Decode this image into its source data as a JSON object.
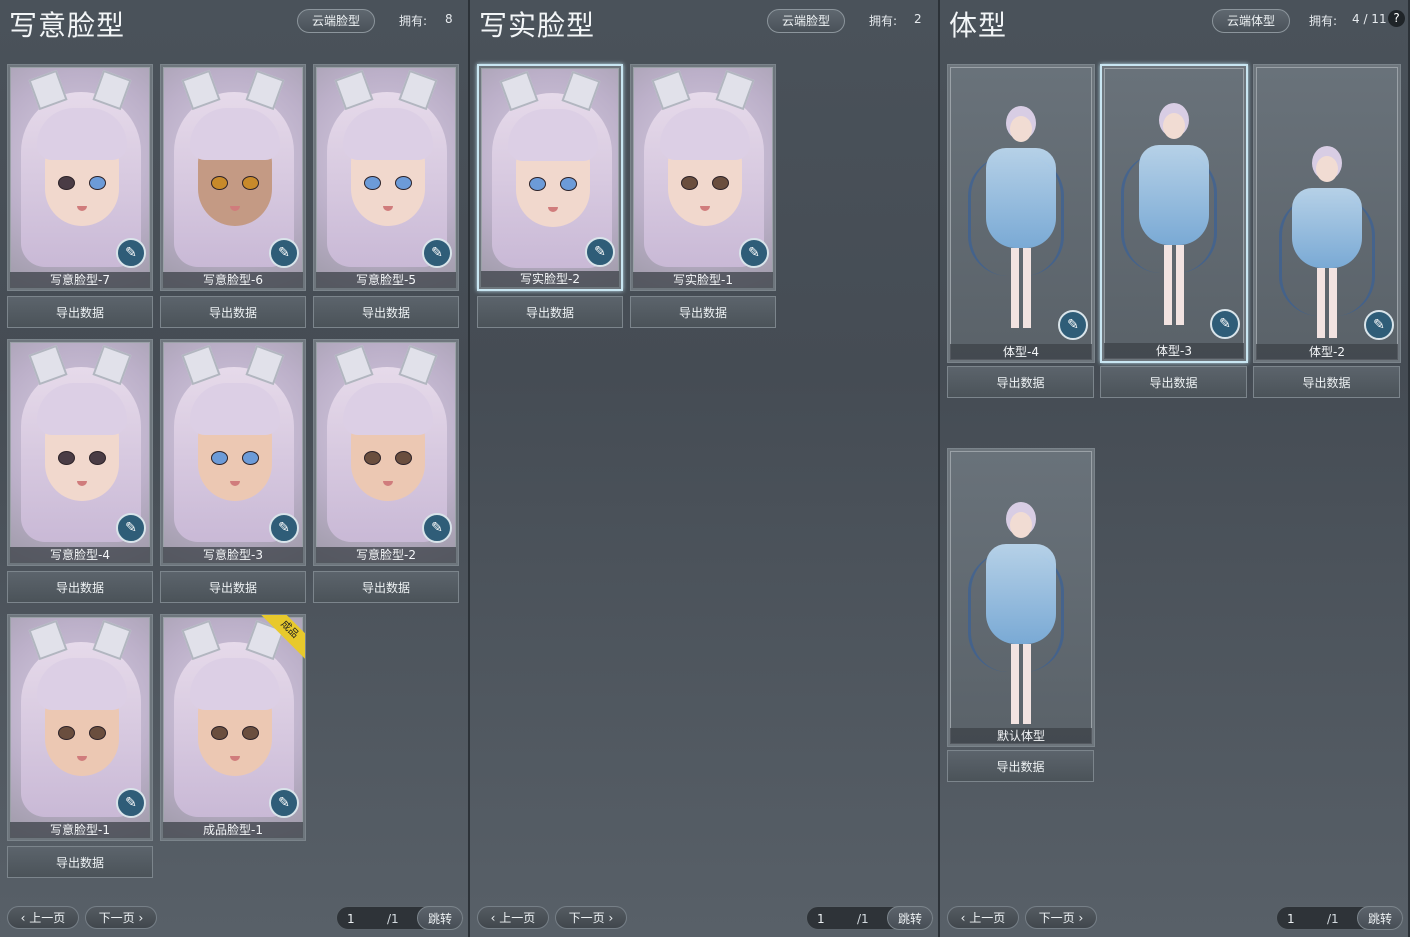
{
  "panels": [
    {
      "title": "写意脸型",
      "cloud_label": "云端脸型",
      "own_label": "拥有:",
      "own_value": "8",
      "cards": [
        {
          "name": "写意脸型-7",
          "export": "导出数据"
        },
        {
          "name": "写意脸型-6",
          "export": "导出数据"
        },
        {
          "name": "写意脸型-5",
          "export": "导出数据"
        },
        {
          "name": "写意脸型-4",
          "export": "导出数据"
        },
        {
          "name": "写意脸型-3",
          "export": "导出数据"
        },
        {
          "name": "写意脸型-2",
          "export": "导出数据"
        },
        {
          "name": "写意脸型-1",
          "export": "导出数据"
        },
        {
          "name": "成品脸型-1",
          "badge": "成品"
        }
      ],
      "pager": {
        "prev": "上一页",
        "next": "下一页",
        "page": "1",
        "total": "/1",
        "jump": "跳转"
      }
    },
    {
      "title": "写实脸型",
      "cloud_label": "云端脸型",
      "own_label": "拥有:",
      "own_value": "2",
      "cards": [
        {
          "name": "写实脸型-2",
          "export": "导出数据"
        },
        {
          "name": "写实脸型-1",
          "export": "导出数据"
        }
      ],
      "pager": {
        "prev": "上一页",
        "next": "下一页",
        "page": "1",
        "total": "/1",
        "jump": "跳转"
      }
    },
    {
      "title": "体型",
      "cloud_label": "云端体型",
      "own_label": "拥有:",
      "own_value": "4 / 11",
      "help": "?",
      "cards": [
        {
          "name": "体型-4",
          "export": "导出数据"
        },
        {
          "name": "体型-3",
          "export": "导出数据"
        },
        {
          "name": "体型-2",
          "export": "导出数据"
        },
        {
          "name": "默认体型",
          "export": "导出数据"
        }
      ],
      "pager": {
        "prev": "上一页",
        "next": "下一页",
        "page": "1",
        "total": "/1",
        "jump": "跳转"
      }
    }
  ],
  "icons": {
    "brush": "brush-icon",
    "prev": "chevron-left-icon",
    "next": "chevron-right-icon",
    "help": "question-icon"
  },
  "colors": {
    "badge": "#e8c92c",
    "selected_border": "#c9e6f2",
    "brush_bg": "#2f5d78"
  }
}
